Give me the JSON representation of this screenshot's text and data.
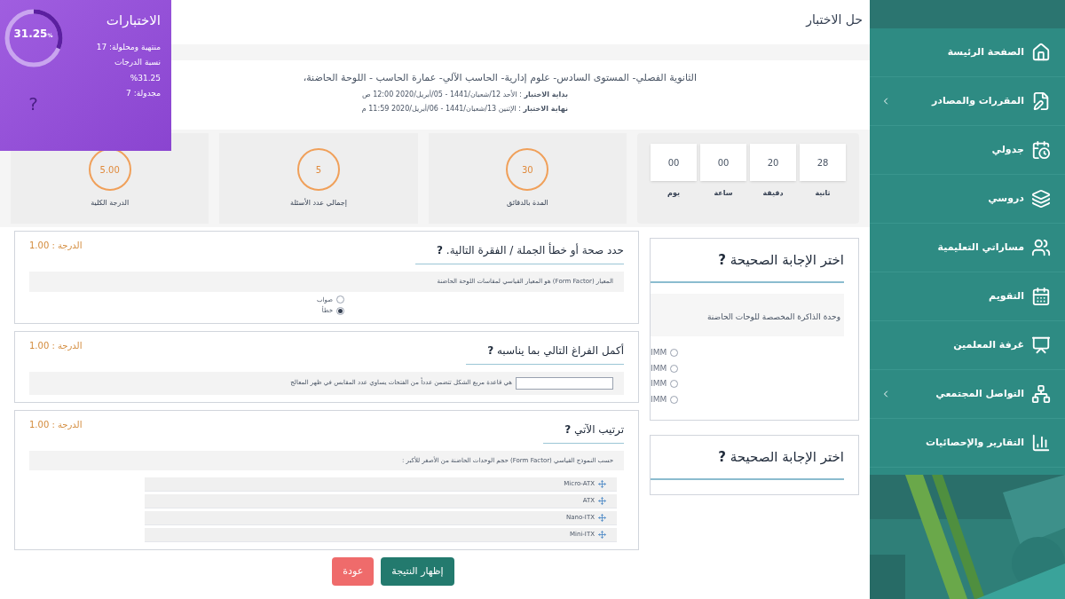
{
  "page_title": "حل الاختبار",
  "overlay": {
    "title": "الاختبارات",
    "percent": "31.25",
    "percent_unit": "%",
    "level": 0.3125,
    "lines": [
      "منتهية ومحلولة: 17",
      "نسبة الدرجات",
      "%31.25",
      "مجدولة: 7"
    ],
    "mark": "?"
  },
  "exam": {
    "title": "الثانوية الفصلي- المستوى السادس- علوم إدارية- الحاسب الآلي- عمارة الحاسب - اللوحة الحاضنة،",
    "start_label": "بداية الاختبار",
    "start_value": ": الأحد 12/شعبان/1441 - 05/أبريل/2020 12:00 ص",
    "end_label": "نهاية الاختبار",
    "end_value": ": الإثنين 13/شعبان/1441 - 06/أبريل/2020 11:59 م"
  },
  "countdown": [
    {
      "value": "28",
      "unit": "ثانية"
    },
    {
      "value": "20",
      "unit": "دقيقة"
    },
    {
      "value": "00",
      "unit": "ساعة"
    },
    {
      "value": "00",
      "unit": "يوم"
    }
  ],
  "stats": [
    {
      "value": "30",
      "label": "المدة بالدقائق"
    },
    {
      "value": "5",
      "label": "إجمالي عدد الأسئلة"
    },
    {
      "value": "5.00",
      "label": "الدرجة الكلية"
    }
  ],
  "questions": [
    {
      "kind": "truefalse",
      "title": "حدد صحة أو خطأ الجملة / الفقرة التالية. **?**",
      "grade": "الدرجة : 1.00",
      "prompt": "المعيار (Form Factor) هو المعيار القياسي لمقاسات اللوحة الحاضنة",
      "options": [
        {
          "label": "صواب",
          "selected": false
        },
        {
          "label": "خطأ",
          "selected": true
        }
      ]
    },
    {
      "kind": "fill",
      "title": "أكمل الفراغ التالي بما يناسبه **?**",
      "grade": "الدرجة : 1.00",
      "prompt": "هي قاعدة مربع الشكل تتضمن عدداً من الفتحات يساوي عدد المقابس في ظهر المعالج"
    },
    {
      "kind": "order",
      "title": "ترتيب الآتي **?**",
      "grade": "الدرجة : 1.00",
      "prompt": "حسب النموذج القياسي (Form Factor) حجم الوحدات الحاضنة من الأصغر للأكبر :",
      "items": [
        "Micro-ATX",
        "ATX",
        "Nano-ITX",
        "Mini-ITX"
      ]
    }
  ],
  "side_questions": [
    {
      "title": "اختر الإجابة الصحيحة **?**",
      "prompt": "وحدة الذاكرة المخصصة للوحات الحاضنة",
      "options": [
        {
          "label": "IMM",
          "selected": false
        },
        {
          "label": "IMM",
          "selected": false
        },
        {
          "label": "IMM",
          "selected": false
        },
        {
          "label": "IMM",
          "selected": false
        }
      ]
    },
    {
      "title": "اختر الإجابة الصحيحة **?**"
    }
  ],
  "buttons": [
    {
      "label": "إظهار النتيجة",
      "kind": "primary"
    },
    {
      "label": "عودة",
      "kind": "danger"
    }
  ],
  "sidebar": {
    "items": [
      {
        "label": "الصفحة الرئيسة",
        "has_submenu": false
      },
      {
        "label": "المقررات والمصادر",
        "has_submenu": true
      },
      {
        "label": "جدولي",
        "has_submenu": false
      },
      {
        "label": "دروسي",
        "has_submenu": false
      },
      {
        "label": "مساراتي التعليمية",
        "has_submenu": false
      },
      {
        "label": "التقويم",
        "has_submenu": false
      },
      {
        "label": "غرفة المعلمين",
        "has_submenu": false
      },
      {
        "label": "التواصل المجتمعي",
        "has_submenu": true
      },
      {
        "label": "التقارير والإحصائيات",
        "has_submenu": false
      }
    ]
  }
}
